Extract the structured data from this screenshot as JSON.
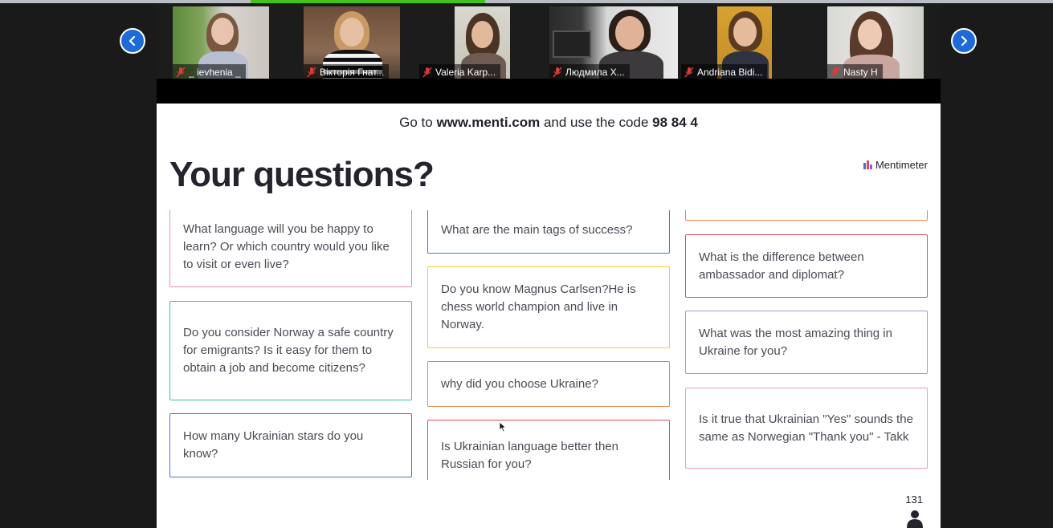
{
  "gallery": {
    "participants": [
      {
        "name": "_ ievhenia _"
      },
      {
        "name": "Вікторія Гнат..."
      },
      {
        "name": "Valeria Karp..."
      },
      {
        "name": "Людмила Х..."
      },
      {
        "name": "Andriana Bidi..."
      },
      {
        "name": "Nasty H"
      }
    ]
  },
  "slide": {
    "instruction_prefix": "Go to ",
    "instruction_url": "www.menti.com",
    "instruction_mid": " and use the code ",
    "instruction_code": "98 84 4",
    "title": "Your questions?",
    "logo_text": "Mentimeter",
    "participant_count": "131",
    "columns": [
      {
        "cards": [
          {
            "text": "What language will you be happy to learn? Or which country would you like to visit or even live?",
            "color": "#e98fa8"
          },
          {
            "text": "Do you consider Norway a safe country for emigrants? Is it easy for them to obtain a job and become citizens?",
            "color": "#2cc8a2"
          },
          {
            "text": "How many Ukrainian stars do you know?",
            "color": "#4a73d9"
          }
        ]
      },
      {
        "cards": [
          {
            "text": "What are the main tags of success?",
            "color": "#4a73d9"
          },
          {
            "text": "Do you know Magnus Carlsen?He is chess world champion and live in Norway.",
            "color": "#f0cf32"
          },
          {
            "text": "why did you choose Ukraine?",
            "color": "#e4874a"
          },
          {
            "text": "Is Ukrainian language better then Russian for you?",
            "color": "#e34a5c"
          }
        ]
      },
      {
        "cards": [
          {
            "text": "",
            "color": "#e4874a"
          },
          {
            "text": "What is the difference between ambassador and diplomat?",
            "color": "#e34a5c"
          },
          {
            "text": "What was the most amazing thing in Ukraine for you?",
            "color": "#a59ad6"
          },
          {
            "text": "Is it true that Ukrainian \"Yes\" sounds the same as Norwegian \"Thank you\" - Takk",
            "color": "#ef9cba"
          }
        ]
      }
    ]
  }
}
